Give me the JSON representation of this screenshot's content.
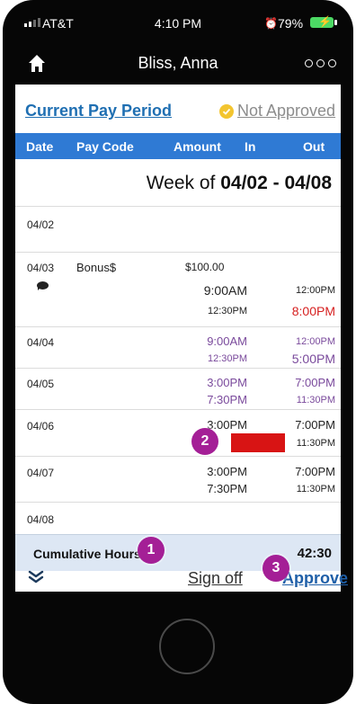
{
  "status_bar": {
    "carrier": "AT&T",
    "time": "4:10 PM",
    "battery": "79%"
  },
  "navbar": {
    "title": "Bliss, Anna",
    "home_icon": "home-icon",
    "more_icon": "more-icon"
  },
  "period": {
    "link": "Current Pay Period",
    "status": "Not Approved"
  },
  "columns": [
    "Date",
    "Pay Code",
    "Amount",
    "In",
    "Out"
  ],
  "week": {
    "prefix": "Week of",
    "range": "04/02 - 04/08"
  },
  "rows": [
    {
      "date": "04/02"
    },
    {
      "date": "04/03",
      "code": "Bonus$",
      "amount": "$100.00",
      "in1": "9:00AM",
      "out1": "12:00PM",
      "in2": "12:30PM",
      "out2": "8:00PM"
    },
    {
      "date": "04/04",
      "in1": "9:00AM",
      "out1": "12:00PM",
      "in2": "12:30PM",
      "out2": "5:00PM"
    },
    {
      "date": "04/05",
      "in1": "3:00PM",
      "out1": "7:00PM",
      "in2": "7:30PM",
      "out2": "11:30PM"
    },
    {
      "date": "04/06",
      "in1": "3:00PM",
      "out1": "7:00PM",
      "out2": "11:30PM"
    },
    {
      "date": "04/07",
      "in1": "3:00PM",
      "out1": "7:00PM",
      "in2": "7:30PM",
      "out2": "11:30PM"
    },
    {
      "date": "04/08"
    }
  ],
  "cumulative": {
    "label": "Cumulative Hours",
    "value": "42:30"
  },
  "footer": {
    "signoff": "Sign off",
    "approve": "Approve"
  },
  "badges": [
    "1",
    "2",
    "3"
  ],
  "colors": {
    "header": "#2f7ad4",
    "link": "#1f6fb2",
    "warning": "#f3c530",
    "badge": "#a41f96",
    "late": "#d61f1f",
    "scheduled": "#7a4a9c",
    "cumulative_bg": "#dde7f4"
  }
}
